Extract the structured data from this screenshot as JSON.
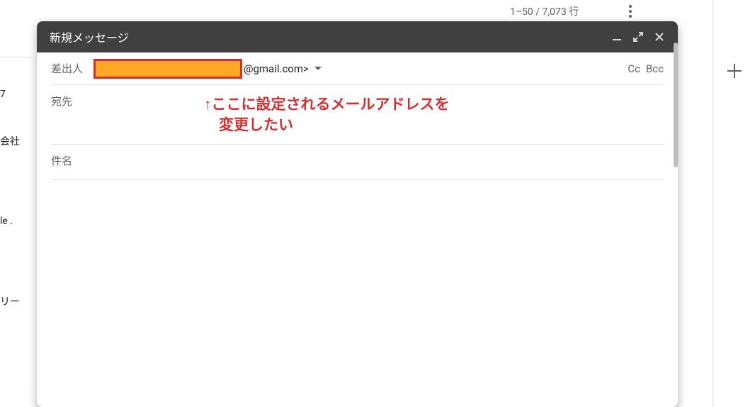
{
  "background": {
    "page_count": "1–50 / 7,073 行",
    "left_edge_items": {
      "item1": "7",
      "item2": "会社",
      "item3": "le .",
      "item4": "リー"
    }
  },
  "compose": {
    "title": "新規メッセージ",
    "from_label": "差出人",
    "from_domain": "@gmail.com>",
    "cc_label": "Cc",
    "bcc_label": "Bcc",
    "to_label": "宛先",
    "subject_label": "件名"
  },
  "annotation": {
    "line1": "↑ここに設定されるメールアドレスを",
    "line2": "　変更したい"
  }
}
